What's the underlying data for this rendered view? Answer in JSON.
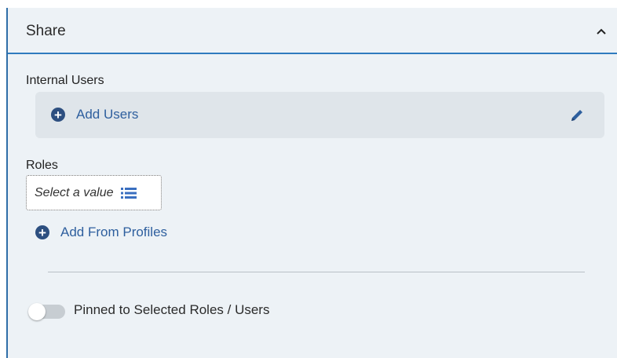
{
  "panel": {
    "title": "Share",
    "collapse_icon": "chevron-up-icon"
  },
  "internal_users": {
    "label": "Internal Users",
    "add_label": "Add Users",
    "add_icon": "plus-circle-icon",
    "edit_icon": "pencil-icon"
  },
  "roles": {
    "label": "Roles",
    "placeholder": "Select a value",
    "list_icon": "list-icon",
    "add_label": "Add From Profiles",
    "add_icon": "plus-circle-icon"
  },
  "pinned": {
    "label": "Pinned to Selected Roles / Users",
    "checked": false
  },
  "colors": {
    "accent": "#2f7bbf",
    "link": "#2e5f9e",
    "icon_dark": "#2d4f80",
    "panel_bg": "#edf2f6",
    "box_bg": "#dfe5ea"
  }
}
